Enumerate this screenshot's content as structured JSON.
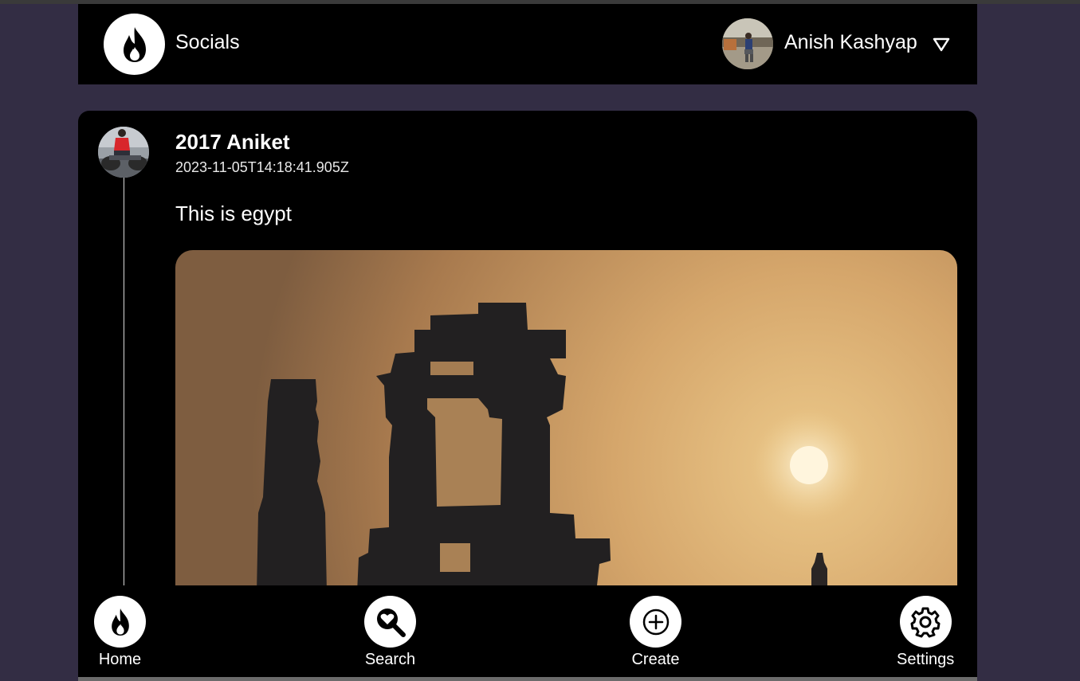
{
  "header": {
    "brand": "Socials",
    "user_name": "Anish Kashyap",
    "logo_icon": "flame-icon",
    "dropdown_icon": "triangle-down-icon"
  },
  "post": {
    "author": "2017 Aniket",
    "timestamp": "2023-11-05T14:18:41.905Z",
    "text": "This is egypt"
  },
  "nav": {
    "items": [
      {
        "label": "Home",
        "icon": "flame-icon"
      },
      {
        "label": "Search",
        "icon": "search-heart-icon"
      },
      {
        "label": "Create",
        "icon": "plus-circle-icon"
      },
      {
        "label": "Settings",
        "icon": "gear-icon"
      }
    ]
  },
  "colors": {
    "page_bg": "#332d44",
    "panel_bg": "#000000",
    "text": "#ffffff"
  }
}
